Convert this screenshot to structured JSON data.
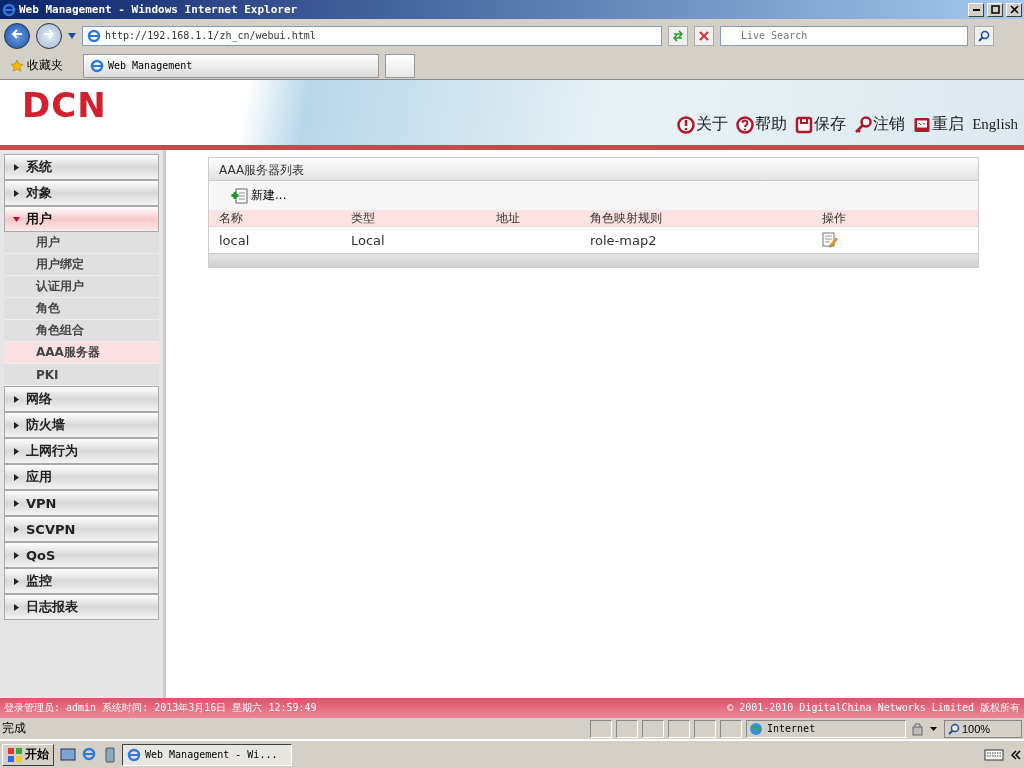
{
  "window": {
    "title": "Web Management - Windows Internet Explorer"
  },
  "browser": {
    "address": "http://192.168.1.1/zh_cn/webui.html",
    "search_placeholder": "Live Search",
    "favorites": "收藏夹",
    "tabs": [
      {
        "label": "Web Management",
        "selected": true
      }
    ]
  },
  "header": {
    "logo": "DCN",
    "actions": [
      {
        "kind": "about",
        "label": "关于"
      },
      {
        "kind": "help",
        "label": "帮助"
      },
      {
        "kind": "save",
        "label": "保存"
      },
      {
        "kind": "logout",
        "label": "注销"
      },
      {
        "kind": "restart",
        "label": "重启"
      }
    ],
    "language": "English"
  },
  "sidebar": {
    "items": [
      {
        "label": "系统",
        "expanded": false
      },
      {
        "label": "对象",
        "expanded": false
      },
      {
        "label": "用户",
        "expanded": true,
        "children": [
          {
            "label": "用户",
            "selected": false
          },
          {
            "label": "用户绑定",
            "selected": false
          },
          {
            "label": "认证用户",
            "selected": false
          },
          {
            "label": "角色",
            "selected": false
          },
          {
            "label": "角色组合",
            "selected": false
          },
          {
            "label": "AAA服务器",
            "selected": true
          },
          {
            "label": "PKI",
            "selected": false
          }
        ]
      },
      {
        "label": "网络",
        "expanded": false
      },
      {
        "label": "防火墙",
        "expanded": false
      },
      {
        "label": "上网行为",
        "expanded": false
      },
      {
        "label": "应用",
        "expanded": false
      },
      {
        "label": "VPN",
        "expanded": false
      },
      {
        "label": "SCVPN",
        "expanded": false
      },
      {
        "label": "QoS",
        "expanded": false
      },
      {
        "label": "监控",
        "expanded": false
      },
      {
        "label": "日志报表",
        "expanded": false
      }
    ]
  },
  "panel": {
    "title": "AAA服务器列表",
    "new_button": "新建...",
    "table": {
      "columns": [
        "名称",
        "类型",
        "地址",
        "角色映射规则",
        "操作"
      ],
      "rows": [
        [
          "local",
          "Local",
          "",
          "role-map2"
        ]
      ]
    }
  },
  "footer": {
    "login": "登录管理员: admin 系统时间: 2013年3月16日 星期六 12:59:49",
    "copyright": "© 2001-2010 DigitalChina Networks Limited 版权所有"
  },
  "status_bar": {
    "text": "完成",
    "zone": "Internet",
    "zoom": "100%"
  },
  "taskbar": {
    "start": "开始",
    "tasks": [
      {
        "label": "Web Management - Wi...",
        "selected": true
      }
    ]
  }
}
